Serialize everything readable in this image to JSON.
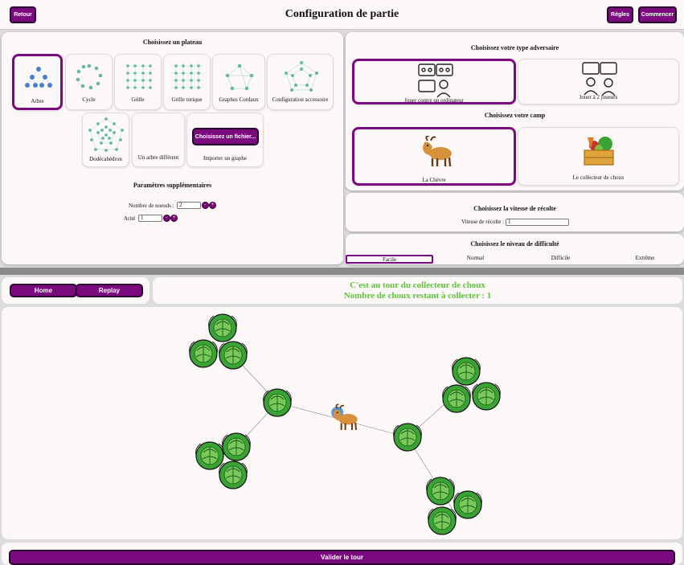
{
  "header": {
    "back_label": "Retour",
    "title": "Configuration de partie",
    "rules_label": "Règles",
    "start_label": "Commencer"
  },
  "board": {
    "title": "Choisissez un plateau",
    "options": [
      "Arbre",
      "Cycle",
      "Grille",
      "Grille torique",
      "Graphes Cordaux",
      "Configuration accessoire",
      "Dodécahèdron",
      "Un arbre différent"
    ],
    "file_button": "Choisissez un fichier...",
    "import_label": "Importer un graphe"
  },
  "extra_params": {
    "title": "Paramètres supplémentaires",
    "nodes_label": "Nombre de noeuds :",
    "nodes_value": "2",
    "edge_label": "Arité",
    "edge_value": "1"
  },
  "opponent": {
    "title": "Choisissez votre type adversaire",
    "options": [
      "Jouer contre un ordinateur",
      "Jouer à 2 joueurs"
    ]
  },
  "camp": {
    "title": "Choisissez votre camp",
    "options": [
      "La Chèvre",
      "Le collecteur de choux"
    ]
  },
  "speed": {
    "title": "Choisissez la vitesse de récolte",
    "label": "Vitesse de récolte :",
    "value": "1"
  },
  "difficulty": {
    "title": "Choisissez le niveau de difficulté",
    "options": [
      "Facile",
      "Normal",
      "Difficile",
      "Extrême"
    ]
  },
  "game": {
    "home_label": "Home",
    "replay_label": "Replay",
    "status_line1": "C'est au tour du collecteur de choux",
    "status_line2": "Nombre de choux restant à collecter : 1",
    "validate_label": "Valider le tour"
  },
  "colors": {
    "accent": "#7a0a7e",
    "status": "#5ec23a",
    "node": "#3aa335"
  },
  "icons": [
    "computer-players-icon",
    "two-players-icon",
    "goat-icon",
    "vegetable-crate-icon",
    "cabbage-icon"
  ]
}
